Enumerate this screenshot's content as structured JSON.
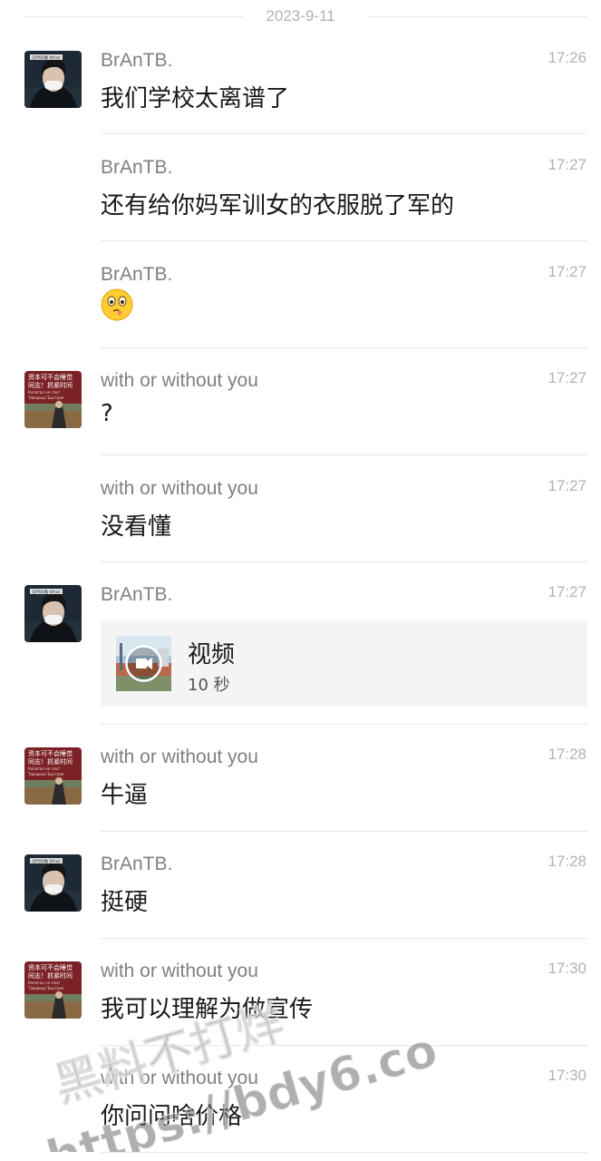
{
  "date_separator": "2023-9-11",
  "messages": [
    {
      "sender": "BrAnTB.",
      "time": "17:26",
      "text": "我们学校太离谱了",
      "avatar": "brantb"
    },
    {
      "sender": "BrAnTB.",
      "time": "17:27",
      "text": "还有给你妈军训女的衣服脱了军的"
    },
    {
      "sender": "BrAnTB.",
      "time": "17:27",
      "emoji": "wry-face-emoji"
    },
    {
      "sender": "with or without you",
      "time": "17:27",
      "text": "?",
      "avatar": "poster"
    },
    {
      "sender": "with or without you",
      "time": "17:27",
      "text": "没看懂"
    },
    {
      "sender": "BrAnTB.",
      "time": "17:27",
      "avatar": "brantb",
      "video": {
        "title": "视频",
        "duration": "10 秒"
      }
    },
    {
      "sender": "with or without you",
      "time": "17:28",
      "text": "牛逼",
      "avatar": "poster"
    },
    {
      "sender": "BrAnTB.",
      "time": "17:28",
      "text": "挺硬",
      "avatar": "brantb"
    },
    {
      "sender": "with or without you",
      "time": "17:30",
      "text": "我可以理解为做宣传",
      "avatar": "poster"
    },
    {
      "sender": "with or without you",
      "time": "17:30",
      "text": "你问问啥价格"
    }
  ],
  "avatars": {
    "brantb": {
      "caption": "没时间做 What"
    },
    "poster": {
      "line1": "资本可不会睡觉",
      "line2": "同志！抓紧时间",
      "line3": "Капитал не спит",
      "line4": "Товарищ! Быстрее"
    }
  },
  "watermark": {
    "line1": "黑料不打烊",
    "line2": "https://bdy6.co"
  },
  "colors": {
    "sender": "#808080",
    "time": "#b2b2b2",
    "divider": "#e7e7e7",
    "card": "#f4f4f4"
  }
}
